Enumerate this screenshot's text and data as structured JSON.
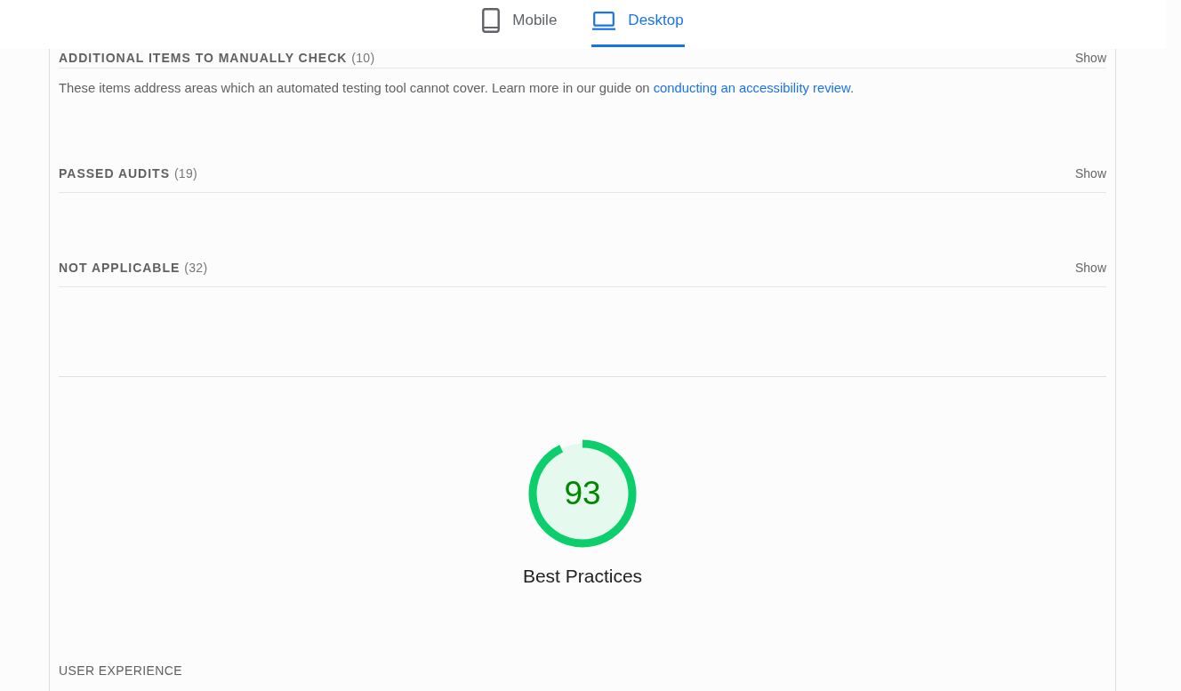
{
  "tabs": [
    {
      "kind": "mobile",
      "label": "Mobile",
      "selected": false
    },
    {
      "kind": "desktop",
      "label": "Desktop",
      "selected": true
    }
  ],
  "groups": [
    {
      "title": "ADDITIONAL ITEMS TO MANUALLY CHECK",
      "count": "(10)",
      "toggle": "Show",
      "description": {
        "text": "These items address areas which an automated testing tool cannot cover. Learn more in our guide on ",
        "link": "conducting an accessibility review",
        "after": "."
      }
    },
    {
      "title": "PASSED AUDITS",
      "count": "(19)",
      "toggle": "Show"
    },
    {
      "title": "NOT APPLICABLE",
      "count": "(32)",
      "toggle": "Show"
    }
  ],
  "category": {
    "score": "93",
    "level": 0.93,
    "title": "Best Practices"
  },
  "next_section": {
    "title": "USER EXPERIENCE"
  }
}
